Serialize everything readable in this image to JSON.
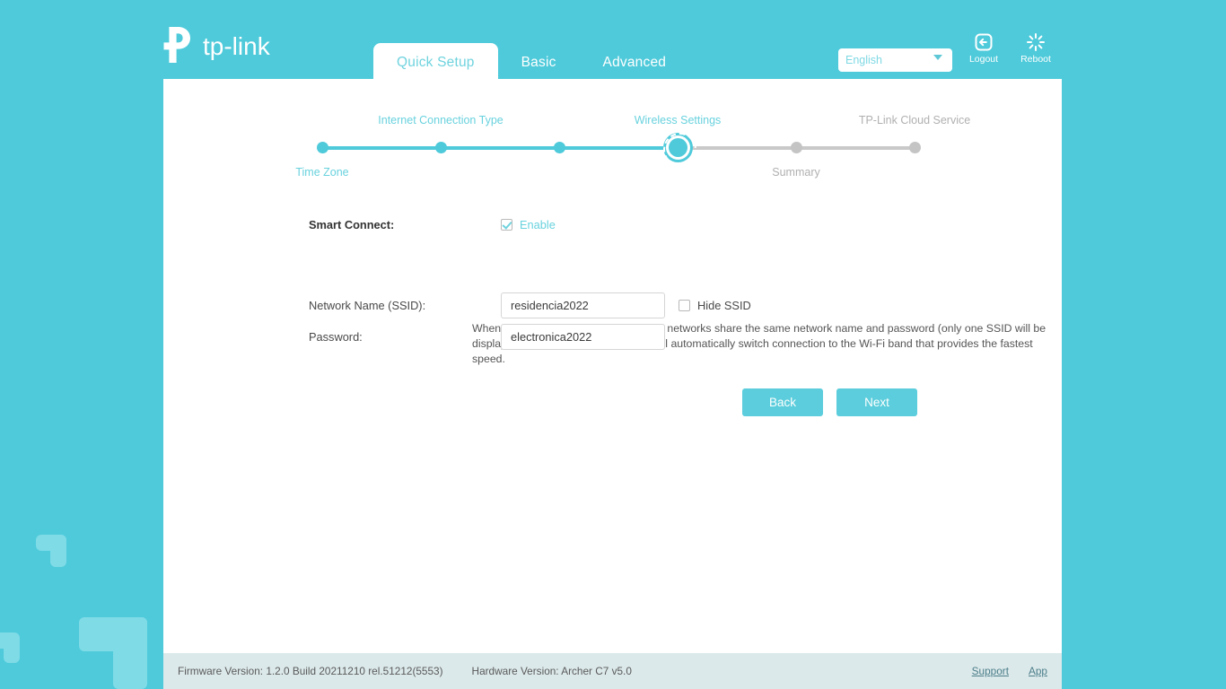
{
  "brand": {
    "logo_text": "tp-link"
  },
  "header": {
    "tabs": [
      {
        "label": "Quick Setup",
        "active": true
      },
      {
        "label": "Basic",
        "active": false
      },
      {
        "label": "Advanced",
        "active": false
      }
    ],
    "language": {
      "selected": "English",
      "options": [
        "English"
      ]
    },
    "logout_label": "Logout",
    "reboot_label": "Reboot"
  },
  "stepper": {
    "steps": [
      {
        "label": "Time Zone",
        "state": "done",
        "position": "below"
      },
      {
        "label": "Internet Connection Type",
        "state": "done",
        "position": "above"
      },
      {
        "label": "",
        "state": "done",
        "position": "above"
      },
      {
        "label": "Wireless Settings",
        "state": "current",
        "position": "above"
      },
      {
        "label": "Summary",
        "state": "todo",
        "position": "below"
      },
      {
        "label": "TP-Link Cloud Service",
        "state": "todo",
        "position": "above"
      }
    ]
  },
  "form": {
    "smart_connect_label": "Smart Connect:",
    "enable_label": "Enable",
    "enable_checked": true,
    "description": "When enabled, the 2.4 GHz and 5 GHz networks share the same network name and password (only one SSID will be displayed), and your wireless device will automatically switch connection to the Wi-Fi band that provides the fastest speed.",
    "ssid_label": "Network Name (SSID):",
    "ssid_value": "residencia2022",
    "ssid_placeholder": "",
    "hide_ssid_label": "Hide SSID",
    "hide_ssid_checked": false,
    "password_label": "Password:",
    "password_value": "electronica2022",
    "password_placeholder": "",
    "back_label": "Back",
    "next_label": "Next"
  },
  "footer": {
    "firmware": "Firmware Version: 1.2.0 Build 20211210 rel.51212(5553)",
    "hardware": "Hardware Version: Archer C7 v5.0",
    "support_label": "Support",
    "app_label": "App"
  },
  "colors": {
    "brand_teal": "#4ecada",
    "accent": "#5bcddc",
    "muted_gray": "#c4c4c4",
    "footer_bg": "#dce9ea"
  }
}
